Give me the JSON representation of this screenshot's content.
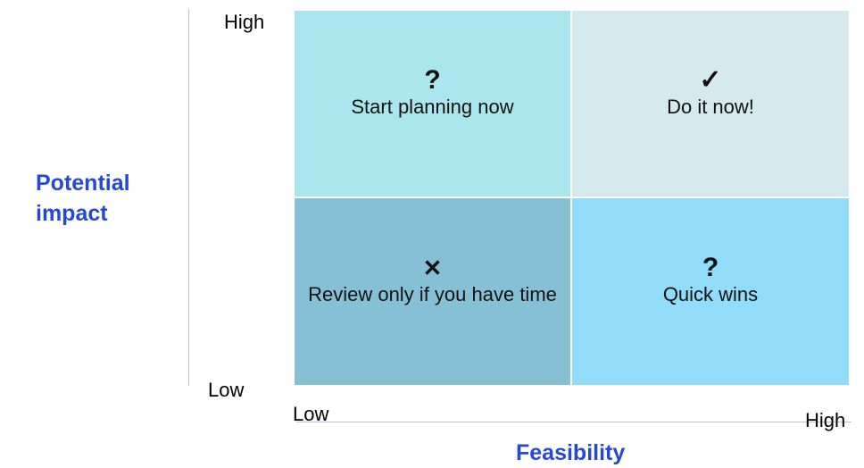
{
  "y_axis": {
    "title": "Potential impact",
    "high": "High",
    "low": "Low"
  },
  "x_axis": {
    "title": "Feasibility",
    "low": "Low",
    "high": "High"
  },
  "quadrants": [
    {
      "position": "top-left",
      "icon": "question-mark-icon",
      "symbol": "?",
      "label": "Start planning now",
      "color": "#abe6ef"
    },
    {
      "position": "top-right",
      "icon": "check-mark-icon",
      "symbol": "✓",
      "label": "Do it now!",
      "color": "#d5eaef"
    },
    {
      "position": "bottom-left",
      "icon": "cross-icon",
      "symbol": "✕",
      "label": "Review only if you have time",
      "color": "#86c0d4"
    },
    {
      "position": "bottom-right",
      "icon": "question-mark-icon",
      "symbol": "?",
      "label": "Quick wins",
      "color": "#91dcf8"
    }
  ],
  "colors": {
    "axis_title": "#2747d6",
    "axis_line": "#b9c3cf"
  }
}
